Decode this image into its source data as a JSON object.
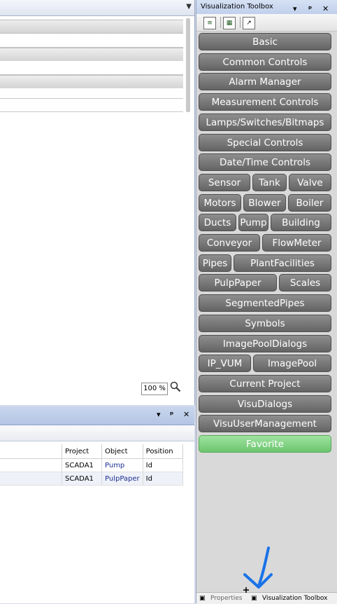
{
  "editor": {
    "zoom_level": "100 %",
    "icons": {
      "zoom": "magnifier-icon",
      "menu": "chevron-down-icon"
    }
  },
  "bottom_panel": {
    "controls": {
      "menu": "▾",
      "pin": "ᵖ",
      "close": "✕"
    },
    "columns": [
      "Project",
      "Object",
      "Position"
    ],
    "rows": [
      {
        "project": "SCADA1",
        "object": "Pump",
        "position": "Id"
      },
      {
        "project": "SCADA1",
        "object": "PulpPaper",
        "position": "Id"
      }
    ]
  },
  "toolbox": {
    "title": "Visualization Toolbox",
    "controls": {
      "menu": "▾",
      "pin": "ᵖ",
      "close": "✕"
    },
    "toolbar_icons": [
      "page-icon",
      "page-green-icon",
      "chart-window-icon"
    ],
    "buttons": [
      [
        "Basic"
      ],
      [
        "Common Controls"
      ],
      [
        "Alarm Manager"
      ],
      [
        "Measurement Controls"
      ],
      [
        "Lamps/Switches/Bitmaps"
      ],
      [
        "Special Controls"
      ],
      [
        "Date/Time Controls"
      ],
      [
        "Sensor",
        "Tank",
        "Valve"
      ],
      [
        "Motors",
        "Blower",
        "Boiler"
      ],
      [
        "Ducts",
        "Pump",
        "Building"
      ],
      [
        "Conveyor",
        "FlowMeter"
      ],
      [
        "Pipes",
        "PlantFacilities"
      ],
      [
        "PulpPaper",
        "Scales"
      ],
      [
        "SegmentedPipes"
      ],
      [
        "Symbols"
      ],
      [
        "ImagePoolDialogs"
      ],
      [
        "IP_VUM",
        "ImagePool"
      ],
      [
        "Current Project"
      ],
      [
        "VisuDialogs"
      ],
      [
        "VisuUserManagement"
      ]
    ],
    "favorite_label": "Favorite",
    "colors": {
      "button": "#7a7a7a",
      "favorite": "#7fd183",
      "annotation_arrow": "#1a73e8"
    },
    "bottom_tabs": [
      "Properties",
      "Visualization Toolbox"
    ]
  }
}
